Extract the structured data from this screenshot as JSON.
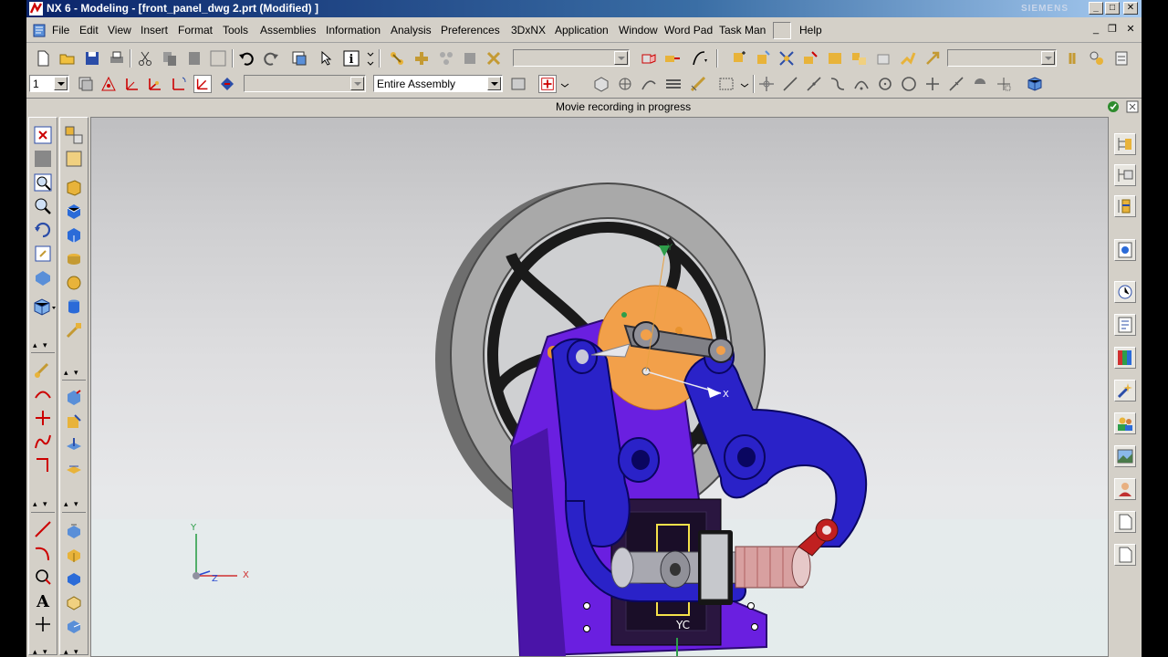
{
  "window": {
    "title": "NX 6 - Modeling - [front_panel_dwg 2.prt (Modified) ]",
    "brand": "SIEMENS",
    "minimize_label": "_",
    "maximize_label": "□",
    "close_label": "✕"
  },
  "menubar": {
    "items": [
      {
        "label": "File",
        "key": "F"
      },
      {
        "label": "Edit",
        "key": "E"
      },
      {
        "label": "View",
        "key": "V"
      },
      {
        "label": "Insert",
        "key": "s"
      },
      {
        "label": "Format",
        "key": "r"
      },
      {
        "label": "Tools",
        "key": "T"
      },
      {
        "label": "Assemblies",
        "key": "A"
      },
      {
        "label": "Information",
        "key": "I"
      },
      {
        "label": "Analysis",
        "key": "l"
      },
      {
        "label": "Preferences",
        "key": "P"
      },
      {
        "label": "3DxNX",
        "key": ""
      },
      {
        "label": "Application",
        "key": "n"
      },
      {
        "label": "Window",
        "key": "W"
      },
      {
        "label": "Word Pad",
        "key": ""
      },
      {
        "label": "Task Man",
        "key": ""
      },
      {
        "label": "Help",
        "key": "H"
      }
    ],
    "mdi_min": "_",
    "mdi_restore": "❐",
    "mdi_close": "✕"
  },
  "toolbar2": {
    "layer_value": "1",
    "filter_value": "",
    "assembly_scope": "Entire Assembly"
  },
  "status": {
    "message": "Movie recording in progress"
  },
  "viewport": {
    "triad_labels": {
      "x": "X",
      "y": "Y",
      "z": "Z"
    },
    "wcs_labels": {
      "x": "X",
      "y": "Y",
      "yc": "YC"
    }
  },
  "colors": {
    "title_gradient_start": "#0a246a",
    "chrome": "#d4d0c8",
    "frame_blue": "#2a22c8",
    "base_purple": "#6a1fe0",
    "disc_orange": "#f2a04a",
    "flywheel_gray": "#9a9a9a"
  }
}
